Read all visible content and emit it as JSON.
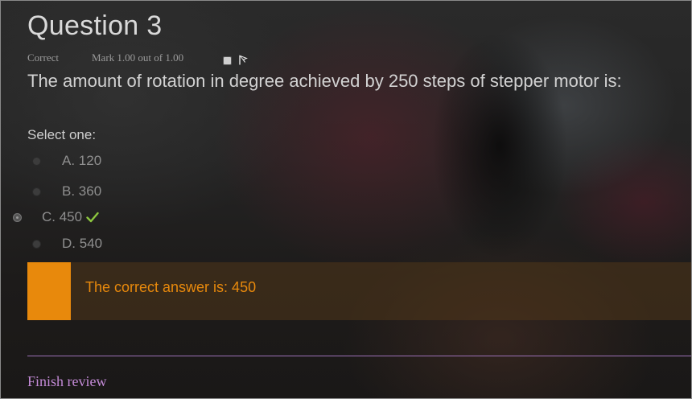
{
  "question": {
    "title": "Question 3",
    "status": "Correct",
    "mark": "Mark 1.00 out of 1.00",
    "text": "The amount of rotation in degree achieved by 250 steps of stepper motor is:",
    "prompt": "Select one:"
  },
  "options": [
    {
      "label": "A. 120",
      "selected": false
    },
    {
      "label": "B. 360",
      "selected": false
    },
    {
      "label": "C. 450",
      "selected": true,
      "correct_icon": "check-icon"
    },
    {
      "label": "D. 540",
      "selected": false
    }
  ],
  "feedback": {
    "text": "The correct answer is: 450",
    "accent_color": "#e8890c"
  },
  "footer": {
    "finish_label": "Finish review",
    "link_color": "#c38ad6"
  },
  "icons": {
    "flag": "flag-icon",
    "check": "check-icon"
  }
}
